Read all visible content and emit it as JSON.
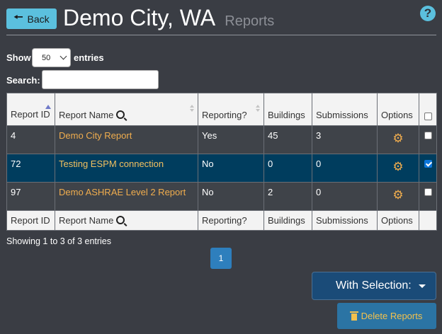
{
  "header": {
    "back_label": "Back",
    "title": "Demo City, WA",
    "subtitle": "Reports",
    "help_icon": "?"
  },
  "controls": {
    "show_label": "Show",
    "page_length": "50",
    "entries_label": "entries",
    "search_label": "Search:",
    "search_value": ""
  },
  "table": {
    "columns": [
      "Report ID",
      "Report Name",
      "Reporting?",
      "Buildings",
      "Submissions",
      "Options"
    ],
    "rows": [
      {
        "id": "4",
        "name": "Demo City Report",
        "reporting": "Yes",
        "buildings": "45",
        "submissions": "3",
        "selected": false
      },
      {
        "id": "72",
        "name": "Testing ESPM connection",
        "reporting": "No",
        "buildings": "0",
        "submissions": "0",
        "selected": true
      },
      {
        "id": "97",
        "name": "Demo ASHRAE Level 2 Report",
        "reporting": "No",
        "buildings": "2",
        "submissions": "0",
        "selected": false
      }
    ],
    "footer_columns": [
      "Report ID",
      "Report Name",
      "Reporting?",
      "Buildings",
      "Submissions",
      "Options"
    ]
  },
  "pagination": {
    "info": "Showing 1 to 3 of 3 entries",
    "current_page": "1"
  },
  "actions": {
    "with_selection_label": "With Selection:",
    "delete_label": "Delete Reports"
  },
  "colors": {
    "accent": "#5bc0de",
    "link": "#f0ad4e",
    "selected_row": "#003d5e",
    "background": "#3a3d44"
  },
  "icons": [
    "arrow-left-icon",
    "help-icon",
    "search-icon",
    "sort-icon",
    "gear-icon",
    "checkbox-icon",
    "caret-down-icon",
    "trash-icon"
  ]
}
